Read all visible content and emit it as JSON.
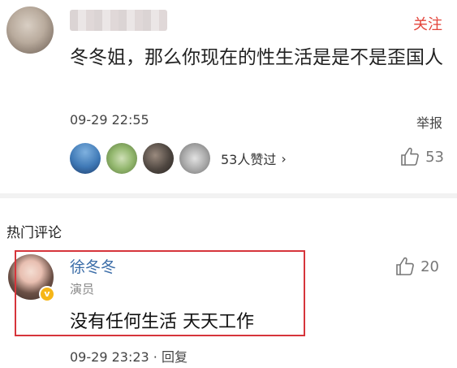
{
  "post": {
    "follow_label": "关注",
    "text": "冬冬姐，那么你现在的性生活是是不是歪国人",
    "time": "09-29 22:55",
    "report_label": "举报",
    "likers_text": "53人赞过",
    "likers_chevron": "›",
    "like_count": "53"
  },
  "hot_comments": {
    "title": "热门评论",
    "comment": {
      "author": "徐冬冬",
      "role": "演员",
      "text": "没有任何生活 天天工作",
      "like_count": "20",
      "time": "09-29 23:23",
      "separator": " · ",
      "reply_label": "回复",
      "verified_badge": "v"
    }
  },
  "colors": {
    "accent": "#e3453b",
    "author_link": "#3b6da8",
    "highlight_border": "#d6353b",
    "verified": "#f6b618"
  }
}
